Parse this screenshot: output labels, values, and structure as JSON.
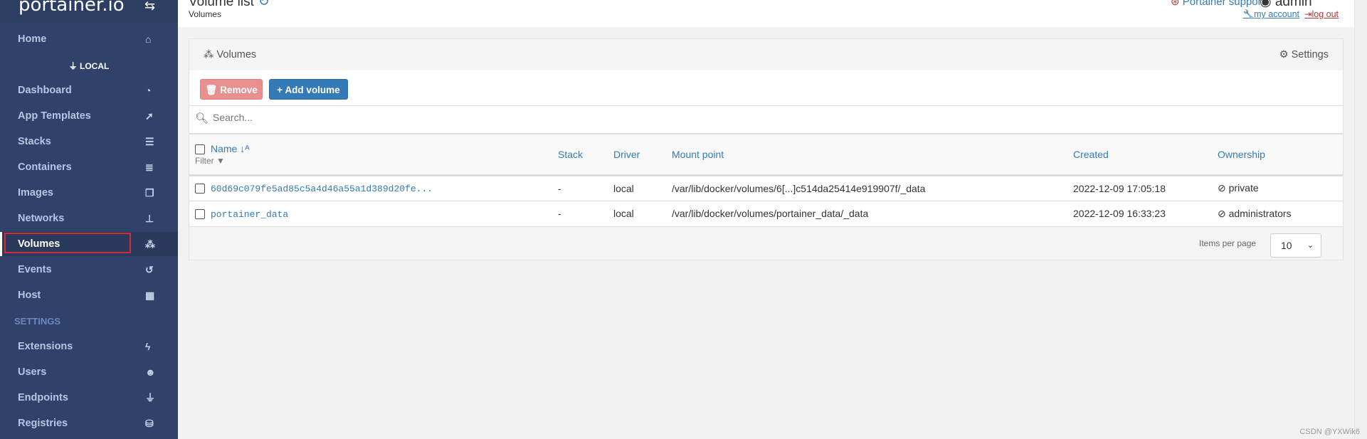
{
  "sidebar": {
    "logo": "portainer.io",
    "endpoint": "LOCAL",
    "settings_label": "SETTINGS",
    "items": [
      {
        "label": "Home",
        "icon": "home-icon"
      },
      {
        "label": "Dashboard",
        "icon": "tachometer-icon"
      },
      {
        "label": "App Templates",
        "icon": "rocket-icon"
      },
      {
        "label": "Stacks",
        "icon": "list-icon"
      },
      {
        "label": "Containers",
        "icon": "server-icon"
      },
      {
        "label": "Images",
        "icon": "clone-icon"
      },
      {
        "label": "Networks",
        "icon": "sitemap-icon"
      },
      {
        "label": "Volumes",
        "icon": "cubes-icon",
        "active": true
      },
      {
        "label": "Events",
        "icon": "history-icon"
      },
      {
        "label": "Host",
        "icon": "grid-icon"
      }
    ],
    "settings_items": [
      {
        "label": "Extensions",
        "icon": "bolt-icon"
      },
      {
        "label": "Users",
        "icon": "users-icon"
      },
      {
        "label": "Endpoints",
        "icon": "plug-icon"
      },
      {
        "label": "Registries",
        "icon": "database-icon"
      }
    ]
  },
  "header": {
    "title": "Volume list",
    "breadcrumb": "Volumes",
    "support": "Portainer support",
    "user": "admin",
    "my_account": "my account",
    "log_out": "log out"
  },
  "panel": {
    "title": "Volumes",
    "settings": "Settings",
    "remove": "Remove",
    "add": "Add volume",
    "search_placeholder": "Search...",
    "columns": {
      "name": "Name",
      "filter": "Filter",
      "stack": "Stack",
      "driver": "Driver",
      "mount": "Mount point",
      "created": "Created",
      "ownership": "Ownership"
    },
    "rows": [
      {
        "name": "60d69c079fe5ad85c5a4d46a55a1d389d20fe...",
        "stack": "-",
        "driver": "local",
        "mount": "/var/lib/docker/volumes/6[...]c514da25414e919907f/_data",
        "created": "2022-12-09 17:05:18",
        "ownership": "private"
      },
      {
        "name": "portainer_data",
        "stack": "-",
        "driver": "local",
        "mount": "/var/lib/docker/volumes/portainer_data/_data",
        "created": "2022-12-09 16:33:23",
        "ownership": "administrators"
      }
    ],
    "items_per_page_label": "Items per page",
    "items_per_page": "10"
  },
  "watermark": "CSDN @YXWik6"
}
